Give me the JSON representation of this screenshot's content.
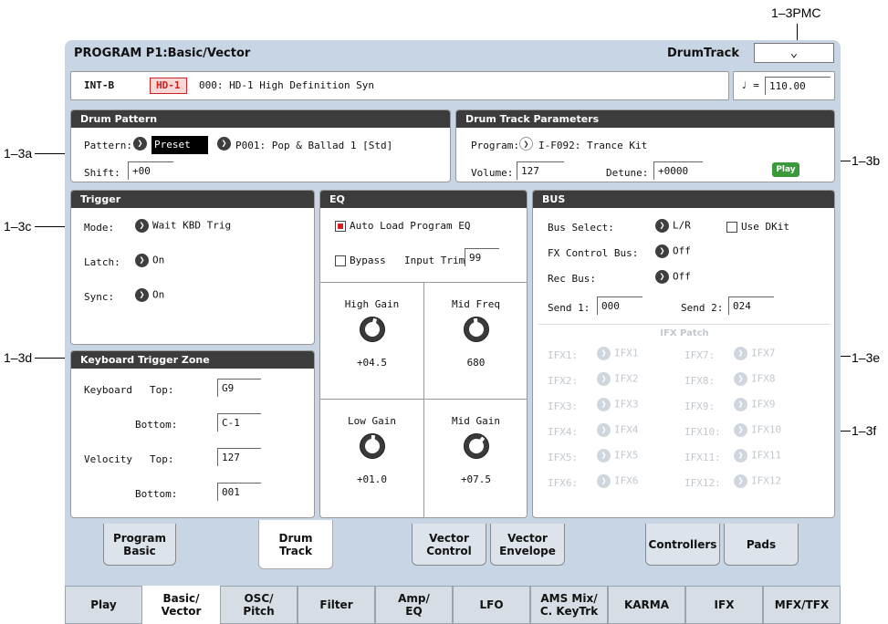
{
  "callouts": {
    "pmc": "1–3PMC",
    "a": "1–3a",
    "b": "1–3b",
    "c": "1–3c",
    "d": "1–3d",
    "e": "1–3e",
    "f": "1–3f"
  },
  "header": {
    "title": "PROGRAM P1:Basic/Vector",
    "page": "DrumTrack",
    "dropdown_icon": "chevron-down-icon"
  },
  "program_bar": {
    "bank": "INT-B",
    "badge": "HD-1",
    "name": "000: HD-1 High Definition Syn",
    "tempo_symbol": "♩ =",
    "tempo": "110.00"
  },
  "drum_pattern": {
    "header": "Drum Pattern",
    "pattern_label": "Pattern:",
    "pattern_type": "Preset",
    "pattern_name": "P001: Pop & Ballad 1 [Std]",
    "shift_label": "Shift:",
    "shift": "+00"
  },
  "drum_track": {
    "header": "Drum Track Parameters",
    "program_label": "Program:",
    "program": "I-F092: Trance Kit",
    "volume_label": "Volume:",
    "volume": "127",
    "detune_label": "Detune:",
    "detune": "+0000",
    "play_label": "Play"
  },
  "trigger": {
    "header": "Trigger",
    "mode_label": "Mode:",
    "mode": "Wait KBD Trig",
    "latch_label": "Latch:",
    "latch": "On",
    "sync_label": "Sync:",
    "sync": "On"
  },
  "kbd_zone": {
    "header": "Keyboard Trigger Zone",
    "keyboard_label": "Keyboard",
    "velocity_label": "Velocity",
    "top_label": "Top:",
    "bottom_label": "Bottom:",
    "kbd_top": "G9",
    "kbd_bottom": "C-1",
    "vel_top": "127",
    "vel_bottom": "001"
  },
  "eq": {
    "header": "EQ",
    "auto_load": "Auto Load Program EQ",
    "bypass": "Bypass",
    "input_trim_label": "Input Trim:",
    "input_trim": "99",
    "high_gain_label": "High Gain",
    "high_gain": "+04.5",
    "mid_freq_label": "Mid Freq",
    "mid_freq": "680",
    "low_gain_label": "Low Gain",
    "low_gain": "+01.0",
    "mid_gain_label": "Mid Gain",
    "mid_gain": "+07.5"
  },
  "bus": {
    "header": "BUS",
    "bus_select_label": "Bus Select:",
    "bus_select": "L/R",
    "use_dkit": "Use DKit",
    "fx_ctrl_label": "FX Control Bus:",
    "fx_ctrl": "Off",
    "rec_bus_label": "Rec Bus:",
    "rec_bus": "Off",
    "send1_label": "Send 1:",
    "send1": "000",
    "send2_label": "Send 2:",
    "send2": "024",
    "ifx_patch": "IFX Patch",
    "ifx": [
      {
        "l": "IFX1:",
        "v": "IFX1"
      },
      {
        "l": "IFX2:",
        "v": "IFX2"
      },
      {
        "l": "IFX3:",
        "v": "IFX3"
      },
      {
        "l": "IFX4:",
        "v": "IFX4"
      },
      {
        "l": "IFX5:",
        "v": "IFX5"
      },
      {
        "l": "IFX6:",
        "v": "IFX6"
      },
      {
        "l": "IFX7:",
        "v": "IFX7"
      },
      {
        "l": "IFX8:",
        "v": "IFX8"
      },
      {
        "l": "IFX9:",
        "v": "IFX9"
      },
      {
        "l": "IFX10:",
        "v": "IFX10"
      },
      {
        "l": "IFX11:",
        "v": "IFX11"
      },
      {
        "l": "IFX12:",
        "v": "IFX12"
      }
    ]
  },
  "page_tabs": [
    {
      "line1": "Program",
      "line2": "Basic"
    },
    {
      "line1": "Drum",
      "line2": "Track"
    },
    {
      "line1": "Vector",
      "line2": "Control"
    },
    {
      "line1": "Vector",
      "line2": "Envelope"
    },
    {
      "line1": "Controllers",
      "line2": ""
    },
    {
      "line1": "Pads",
      "line2": ""
    }
  ],
  "bottom_tabs": [
    {
      "line1": "Play",
      "line2": ""
    },
    {
      "line1": "Basic/",
      "line2": "Vector"
    },
    {
      "line1": "OSC/",
      "line2": "Pitch"
    },
    {
      "line1": "Filter",
      "line2": ""
    },
    {
      "line1": "Amp/",
      "line2": "EQ"
    },
    {
      "line1": "LFO",
      "line2": ""
    },
    {
      "line1": "AMS Mix/",
      "line2": "C. KeyTrk"
    },
    {
      "line1": "KARMA",
      "line2": ""
    },
    {
      "line1": "IFX",
      "line2": ""
    },
    {
      "line1": "MFX/TFX",
      "line2": ""
    }
  ]
}
